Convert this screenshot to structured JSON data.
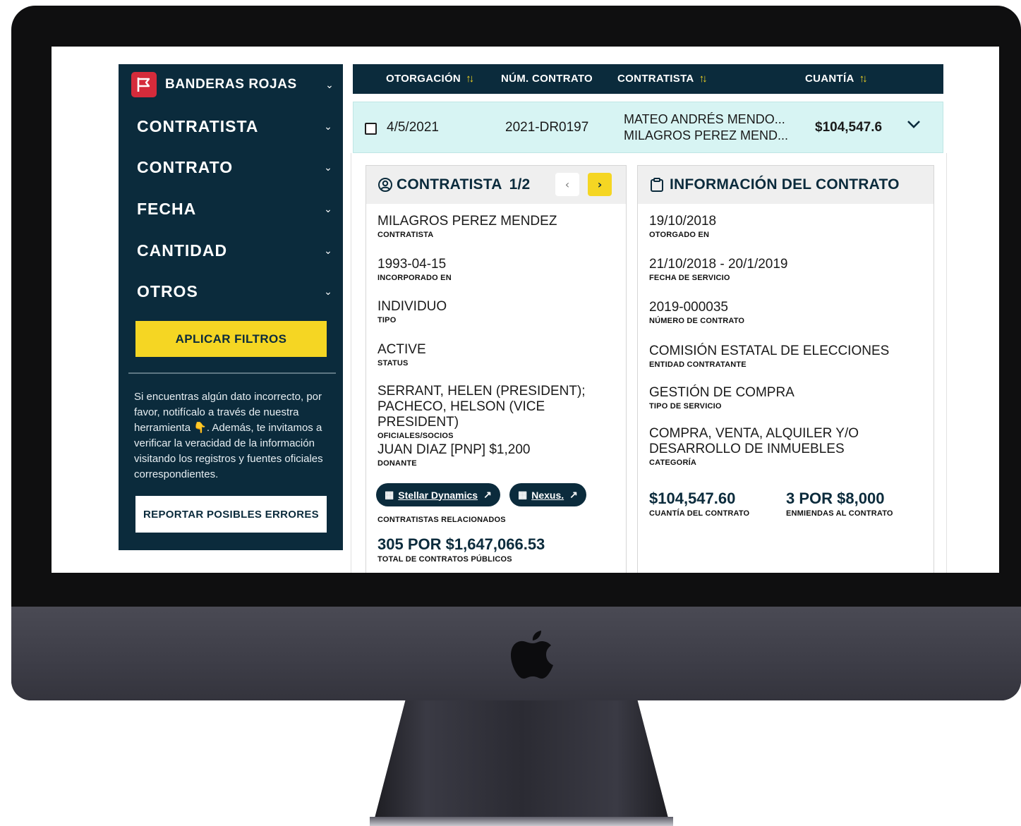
{
  "sidebar": {
    "brand_label": "BANDERAS ROJAS",
    "filters": [
      {
        "label": "CONTRATISTA"
      },
      {
        "label": "CONTRATO"
      },
      {
        "label": "FECHA"
      },
      {
        "label": "CANTIDAD"
      },
      {
        "label": "OTROS"
      }
    ],
    "apply_label": "APLICAR FILTROS",
    "notice": "Si encuentras algún dato incorrecto, por favor, notifícalo a través de nuestra herramienta 👇. Además, te invitamos a verificar la veracidad de la información visitando los registros y fuentes oficiales correspondientes.",
    "report_label": "REPORTAR POSIBLES ERRORES"
  },
  "table": {
    "columns": [
      {
        "label": "OTORGACIÓN",
        "sortable": true
      },
      {
        "label": "NÚM. CONTRATO",
        "sortable": false
      },
      {
        "label": "CONTRATISTA",
        "sortable": true
      },
      {
        "label": "CUANTÍA",
        "sortable": true
      }
    ],
    "row": {
      "date": "4/5/2021",
      "contract_number": "2021-DR0197",
      "contractor_line1": "MATEO ANDRÉS MENDO...",
      "contractor_line2": "MILAGROS PEREZ MEND...",
      "amount": "$104,547.6"
    }
  },
  "contractor_card": {
    "title": "CONTRATISTA",
    "pager": "1/2",
    "fields": [
      {
        "value": "MILAGROS PEREZ MENDEZ",
        "label": "CONTRATISTA"
      },
      {
        "value": "1993-04-15",
        "label": "INCORPORADO EN"
      },
      {
        "value": "INDIVIDUO",
        "label": "TIPO"
      },
      {
        "value": "ACTIVE",
        "label": "STATUS"
      },
      {
        "value_line1": "SERRANT, HELEN (PRESIDENT);",
        "value_line2": "PACHECO, HELSON (VICE PRESIDENT)",
        "label": "OFICIALES/SOCIOS"
      },
      {
        "value": "JUAN DIAZ [PNP] $1,200",
        "label": "DONANTE"
      }
    ],
    "related": [
      "Stellar Dynamics",
      "Nexus."
    ],
    "related_label": "CONTRATISTAS RELACIONADOS",
    "total_value": "305 POR $1,647,066.53",
    "total_label": "TOTAL DE CONTRATOS PÚBLICOS"
  },
  "contract_card": {
    "title": "INFORMACIÓN DEL CONTRATO",
    "fields": [
      {
        "value": "19/10/2018",
        "label": "OTORGADO EN"
      },
      {
        "value": "21/10/2018 - 20/1/2019",
        "label": "FECHA DE SERVICIO"
      },
      {
        "value": "2019-000035",
        "label": "NÚMERO DE CONTRATO"
      },
      {
        "value": "COMISIÓN ESTATAL DE ELECCIONES",
        "label": "ENTIDAD CONTRATANTE"
      },
      {
        "value": "GESTIÓN DE COMPRA",
        "label": "TIPO DE SERVICIO"
      },
      {
        "value_line1": "COMPRA, VENTA, ALQUILER Y/O",
        "value_line2": "DESARROLLO DE INMUEBLES",
        "label": "CATEGORÍA"
      }
    ],
    "amount_value": "$104,547.60",
    "amount_label": "CUANTÍA DEL CONTRATO",
    "amend_value": "3 POR $8,000",
    "amend_label": "ENMIENDAS AL CONTRATO"
  },
  "colors": {
    "navy": "#0b2b3c",
    "yellow": "#f5d623",
    "flag_red": "#d52b3b",
    "row_highlight": "#d7f4f3"
  }
}
